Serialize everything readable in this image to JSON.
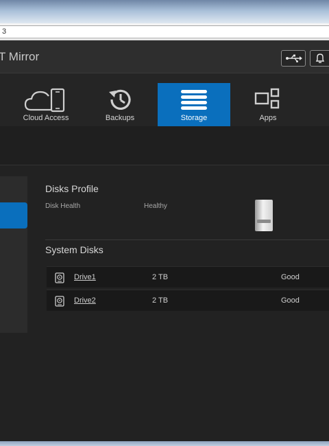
{
  "browser": {
    "url_fragment": "3"
  },
  "header": {
    "app_title": "T Mirror",
    "usb_icon": "usb-icon",
    "alert_icon": "bell-icon"
  },
  "nav": {
    "tabs": [
      {
        "label": "Cloud Access",
        "icon": "cloud-phone-icon",
        "active": false
      },
      {
        "label": "Backups",
        "icon": "history-clock-icon",
        "active": false
      },
      {
        "label": "Storage",
        "icon": "storage-stack-icon",
        "active": true
      },
      {
        "label": "Apps",
        "icon": "apps-grid-icon",
        "active": false
      }
    ]
  },
  "disks_profile": {
    "title": "Disks Profile",
    "health_label": "Disk Health",
    "health_value": "Healthy"
  },
  "system_disks": {
    "title": "System Disks",
    "rows": [
      {
        "name": "Drive1",
        "size": "2 TB",
        "status": "Good"
      },
      {
        "name": "Drive2",
        "size": "2 TB",
        "status": "Good"
      }
    ]
  },
  "colors": {
    "accent": "#0a6fbd",
    "background": "#222222",
    "text": "#d8d8d8"
  }
}
